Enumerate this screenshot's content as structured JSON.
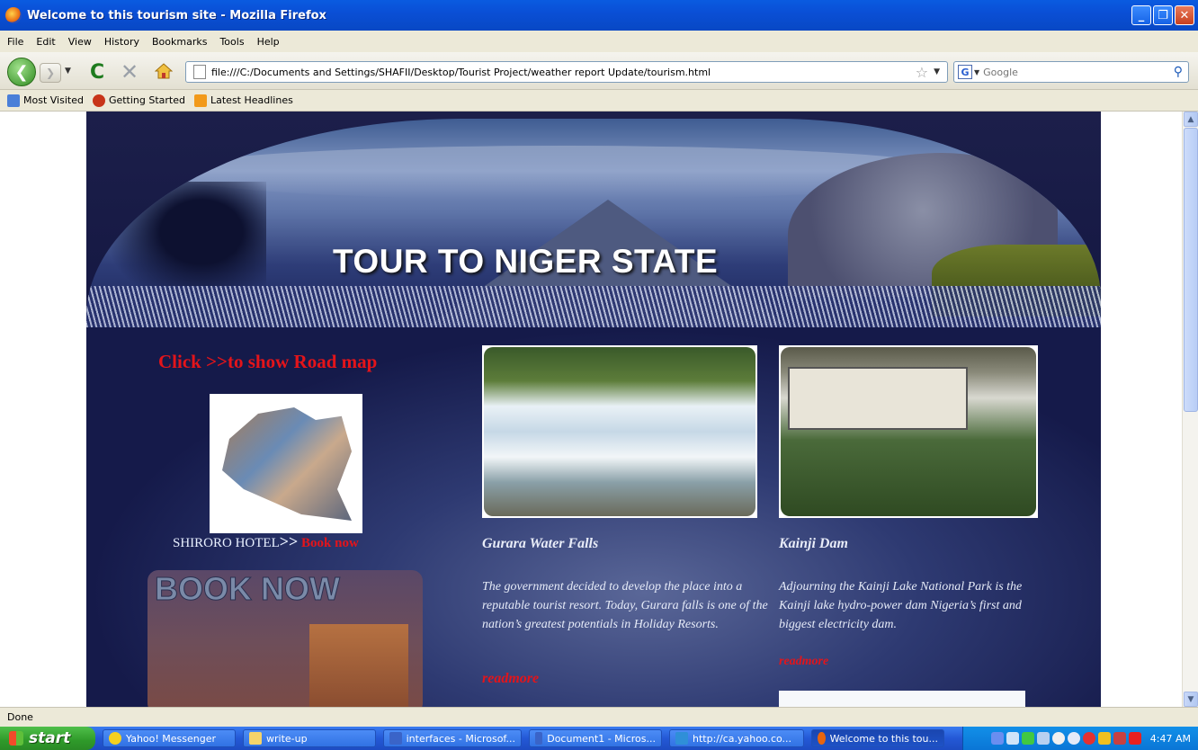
{
  "window": {
    "title": "Welcome to this tourism site - Mozilla Firefox"
  },
  "menu": [
    "File",
    "Edit",
    "View",
    "History",
    "Bookmarks",
    "Tools",
    "Help"
  ],
  "nav": {
    "url": "file:///C:/Documents and Settings/SHAFII/Desktop/Tourist Project/weather report Update/tourism.html",
    "search_placeholder": "Google"
  },
  "bookmarks": [
    "Most Visited",
    "Getting Started",
    "Latest Headlines"
  ],
  "page": {
    "banner_title": "TOUR TO NIGER STATE",
    "road_map_link": "Click >>to show Road map",
    "hotel_name": "SHIRORO HOTEL",
    "hotel_arrows": ">>",
    "book_now_link": "Book now",
    "book_now_banner": "BOOK NOW",
    "attractions": [
      {
        "title": "Gurara Water Falls",
        "text": "The government decided to develop the place into a reputable tourist resort. Today, Gurara falls is one of the nation’s greatest potentials in Holiday Resorts.",
        "readmore": "readmore"
      },
      {
        "title": "Kainji Dam",
        "text": "Adjourning the Kainji Lake National Park is the Kainji lake hydro-power dam Nigeria’s first and biggest electricity dam.",
        "readmore": "readmore"
      }
    ]
  },
  "status": "Done",
  "taskbar": {
    "start": "start",
    "tasks": [
      "Yahoo! Messenger",
      "write-up",
      "interfaces - Microsof...",
      "Document1 - Micros...",
      "http://ca.yahoo.co...",
      "Welcome to this tou..."
    ],
    "clock": "4:47 AM"
  },
  "colors": {
    "accent_red": "#e4141a",
    "titlebar_blue": "#0a5be0",
    "site_navy": "#131641"
  }
}
